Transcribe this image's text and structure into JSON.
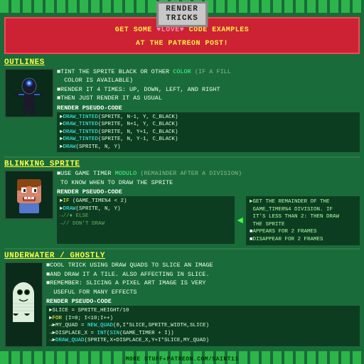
{
  "title": {
    "line1": "RENDER",
    "line2": "TRICKS"
  },
  "promo": {
    "line1": "GET SOME ",
    "heart": "♥LOVE♥",
    "line1b": " CODE EXAMPLES",
    "line2": "AT THE PATREON POST!"
  },
  "sections": [
    {
      "id": "outlines",
      "header": "OUTLINES",
      "bullets": [
        {
          "bullet": "■",
          "text": "TINT THE SPRITE BLACK OR OTHER COLOR",
          "gray": " (IF A FILL\n  COLOR IS AVAILABLE)"
        },
        {
          "bullet": "■",
          "text": "RENDER IT 4 TIMES: UP, DOWN, LEFT, AND RIGHT"
        },
        {
          "bullet": "■",
          "text": "THEN JUST RENDER IT AS USUAL"
        }
      ],
      "pseudo_label": "RENDER PSEUDO-CODE",
      "code": [
        "►DRAW_TINTED(SPRITE, N-1, Y, C_BLACK)",
        "►DRAW_TINTED(SPRITE, N+1, Y, C_BLACK)",
        "►DRAW_TINTED(SPRITE, N, Y+1, C_BLACK)",
        "►DRAW_TINTED(SPRITE, N, Y-1, C_BLACK)",
        "►DRAW(SPRITE, N, Y)"
      ]
    },
    {
      "id": "blinking",
      "header": "BLINKING SPRITE",
      "bullets": [
        {
          "bullet": "■",
          "text": "USE GAME TIMER MODULO",
          "gray": " (REMAINDER AFTER A DIVISION)"
        },
        {
          "bullet": "",
          "text": "TO KNOW WHEN TO DRAW THE SPRITE"
        }
      ],
      "pseudo_label": "RENDER PSEUDO-CODE",
      "code": [
        "►IF (GAME_TIME%4 < 2)",
        "►DRAW(SPRITE, N, Y)",
        "→//♦ ELSE",
        "→//  DON'T DRAW"
      ],
      "side_note": {
        "lines": [
          "►GET THE REMAINDER OF THE",
          " GAME_TIMER%4 DIVISION. IF",
          " IT'S LESS THAN 2: THEN DRAW",
          " THE SPRITE",
          "■APPEARS FOR 2 FRAMES",
          "■DISAPPEAR FOR 2 FRAMES"
        ]
      }
    },
    {
      "id": "underwater",
      "header": "UNDERWATER / GHOSTLY",
      "bullets": [
        {
          "bullet": "■",
          "text": "COOL TRICK USING DRAW QUADS TO SLICE AN IMAGE"
        },
        {
          "bullet": "■",
          "text": "AND DRAW IT A TILE. ALSO AFFECTING IN SLICE."
        },
        {
          "bullet": "■",
          "text": "REMEMBER: SLICING A PIXEL ART IMAGE IS VERY"
        },
        {
          "bullet": "",
          "text": "USEFUL FOR MANY EFFECTS"
        }
      ],
      "pseudo_label": "RENDER PSEUDO-CODE",
      "code": [
        "►SLICE = SPRITE_HEIGHT/10",
        "►FOR (I=0; I<10;I++)",
        "→►MY_QUAD = NEW_QUAD(0,I*SLICE,SPRITE_WIDTH,SLICE)",
        "→►DISPLACE_X = INT(SIN(GAME_TIMER + I))",
        "→►DRAW_QUAD(SPRITE,X+DISPLACE_X,Y+I*SLICE,MY_QUAD)"
      ]
    }
  ],
  "footer": "MORE STUFF▸PATREON.COM/SAINT11"
}
